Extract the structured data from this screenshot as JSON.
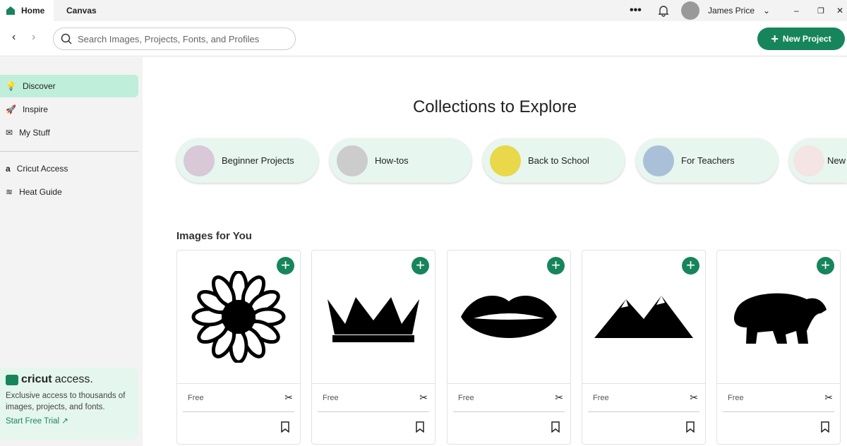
{
  "tabs": {
    "home": "Home",
    "canvas": "Canvas"
  },
  "user": {
    "name": "James Price"
  },
  "search": {
    "placeholder": "Search Images, Projects, Fonts, and Profiles"
  },
  "new_project": "New Project",
  "sidebar": {
    "items": [
      {
        "label": "Discover",
        "icon": "lightbulb-icon"
      },
      {
        "label": "Inspire",
        "icon": "rocket-icon"
      },
      {
        "label": "My Stuff",
        "icon": "folder-icon"
      },
      {
        "label": "Cricut Access",
        "icon": "access-icon"
      },
      {
        "label": "Heat Guide",
        "icon": "heat-icon"
      }
    ]
  },
  "promo": {
    "logo_bold": "cricut",
    "logo_light": "access.",
    "text": "Exclusive access to thousands of images, projects, and fonts.",
    "link": "Start Free Trial ↗"
  },
  "main": {
    "title": "Collections to Explore",
    "collections": [
      {
        "label": "Beginner Projects"
      },
      {
        "label": "How-tos"
      },
      {
        "label": "Back to School"
      },
      {
        "label": "For Teachers"
      },
      {
        "label": "New"
      }
    ],
    "images_title": "Images for You",
    "images": [
      {
        "name": "sunflower",
        "price": "Free"
      },
      {
        "name": "crown",
        "price": "Free"
      },
      {
        "name": "lips",
        "price": "Free"
      },
      {
        "name": "mountains",
        "price": "Free"
      },
      {
        "name": "bear",
        "price": "Free"
      }
    ]
  },
  "colors": {
    "accent": "#17855b",
    "active": "#bfeedb"
  }
}
